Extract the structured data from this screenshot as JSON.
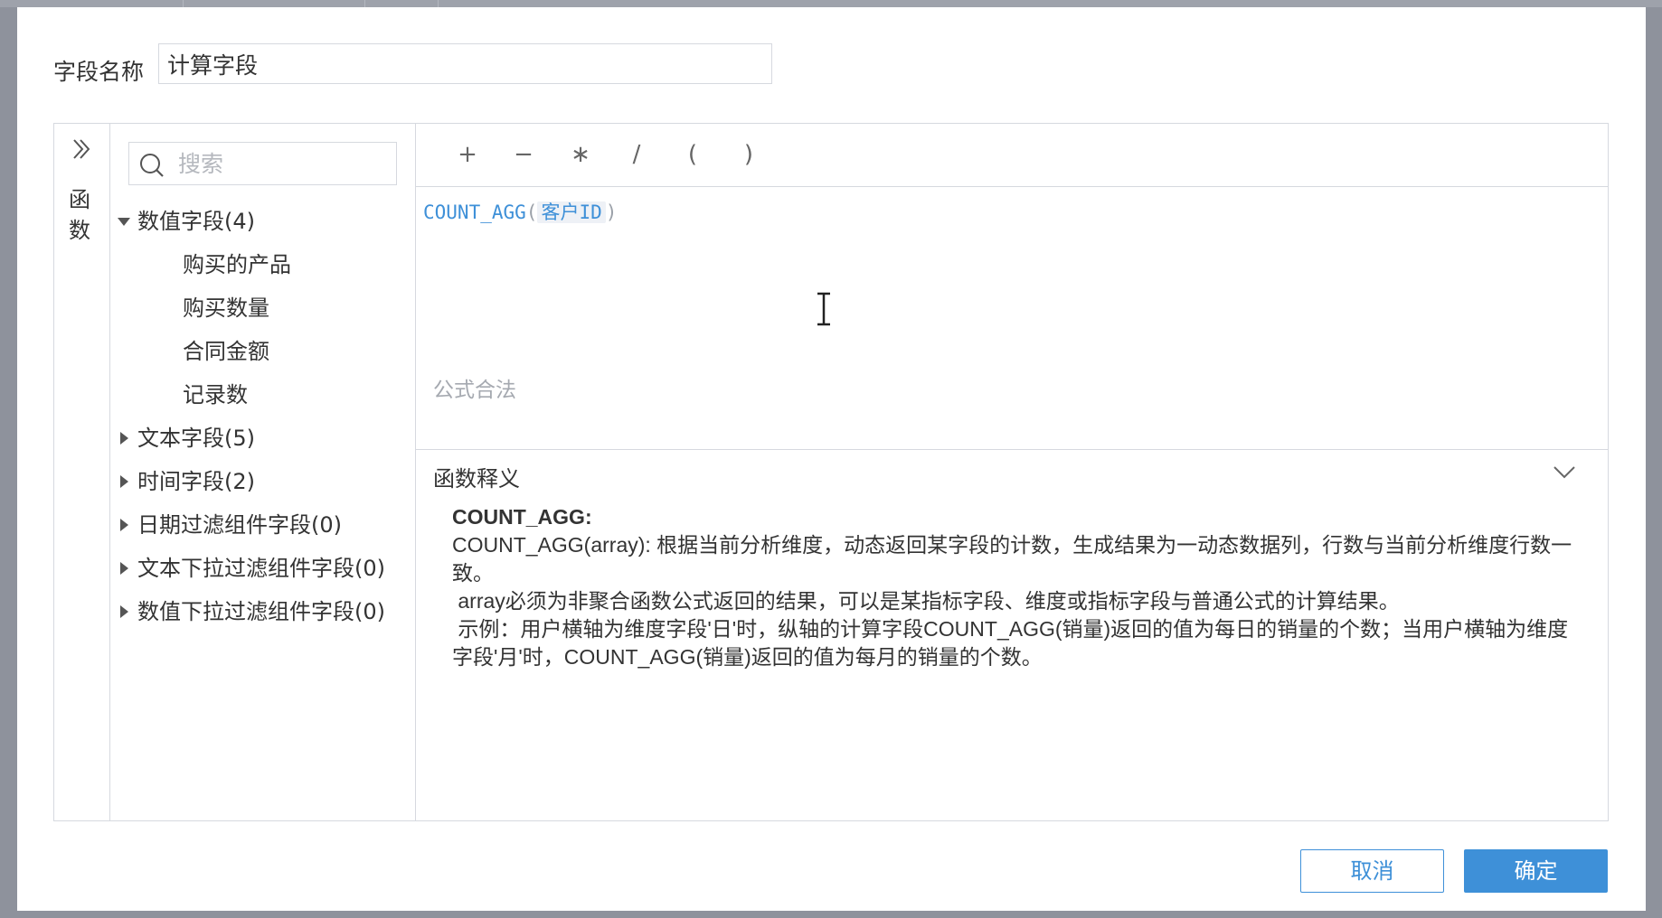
{
  "dialog": {
    "field_name_label": "字段名称",
    "field_name_value": "计算字段"
  },
  "function_rail": {
    "toggle_icon": "double-chevron-right-icon",
    "label": "函数"
  },
  "field_panel": {
    "search_placeholder": "搜索",
    "groups": [
      {
        "label": "数值字段(4)",
        "expanded": true,
        "items": [
          "购买的产品",
          "购买数量",
          "合同金额",
          "记录数"
        ]
      },
      {
        "label": "文本字段(5)",
        "expanded": false,
        "items": []
      },
      {
        "label": "时间字段(2)",
        "expanded": false,
        "items": []
      },
      {
        "label": "日期过滤组件字段(0)",
        "expanded": false,
        "items": []
      },
      {
        "label": "文本下拉过滤组件字段(0)",
        "expanded": false,
        "items": []
      },
      {
        "label": "数值下拉过滤组件字段(0)",
        "expanded": false,
        "items": []
      }
    ]
  },
  "operators": [
    "+",
    "−",
    "∗",
    "/",
    "(",
    ")"
  ],
  "formula": {
    "function": "COUNT_AGG",
    "open_paren": "(",
    "argument": "客户ID",
    "close_paren": ")",
    "validity": "公式合法"
  },
  "help": {
    "title": "函数释义",
    "function_heading": "COUNT_AGG:",
    "paragraphs": [
      "COUNT_AGG(array): 根据当前分析维度，动态返回某字段的计数，生成结果为一动态数据列，行数与当前分析维度行数一致。",
      " array必须为非聚合函数公式返回的结果，可以是某指标字段、维度或指标字段与普通公式的计算结果。",
      " 示例：用户横轴为维度字段'日'时，纵轴的计算字段COUNT_AGG(销量)返回的值为每日的销量的个数；当用户横轴为维度字段'月'时，COUNT_AGG(销量)返回的值为每月的销量的个数。"
    ]
  },
  "buttons": {
    "cancel": "取消",
    "ok": "确定"
  },
  "colors": {
    "accent": "#3e90d8",
    "border": "#d6d9df",
    "overlay": "#8e929c"
  }
}
